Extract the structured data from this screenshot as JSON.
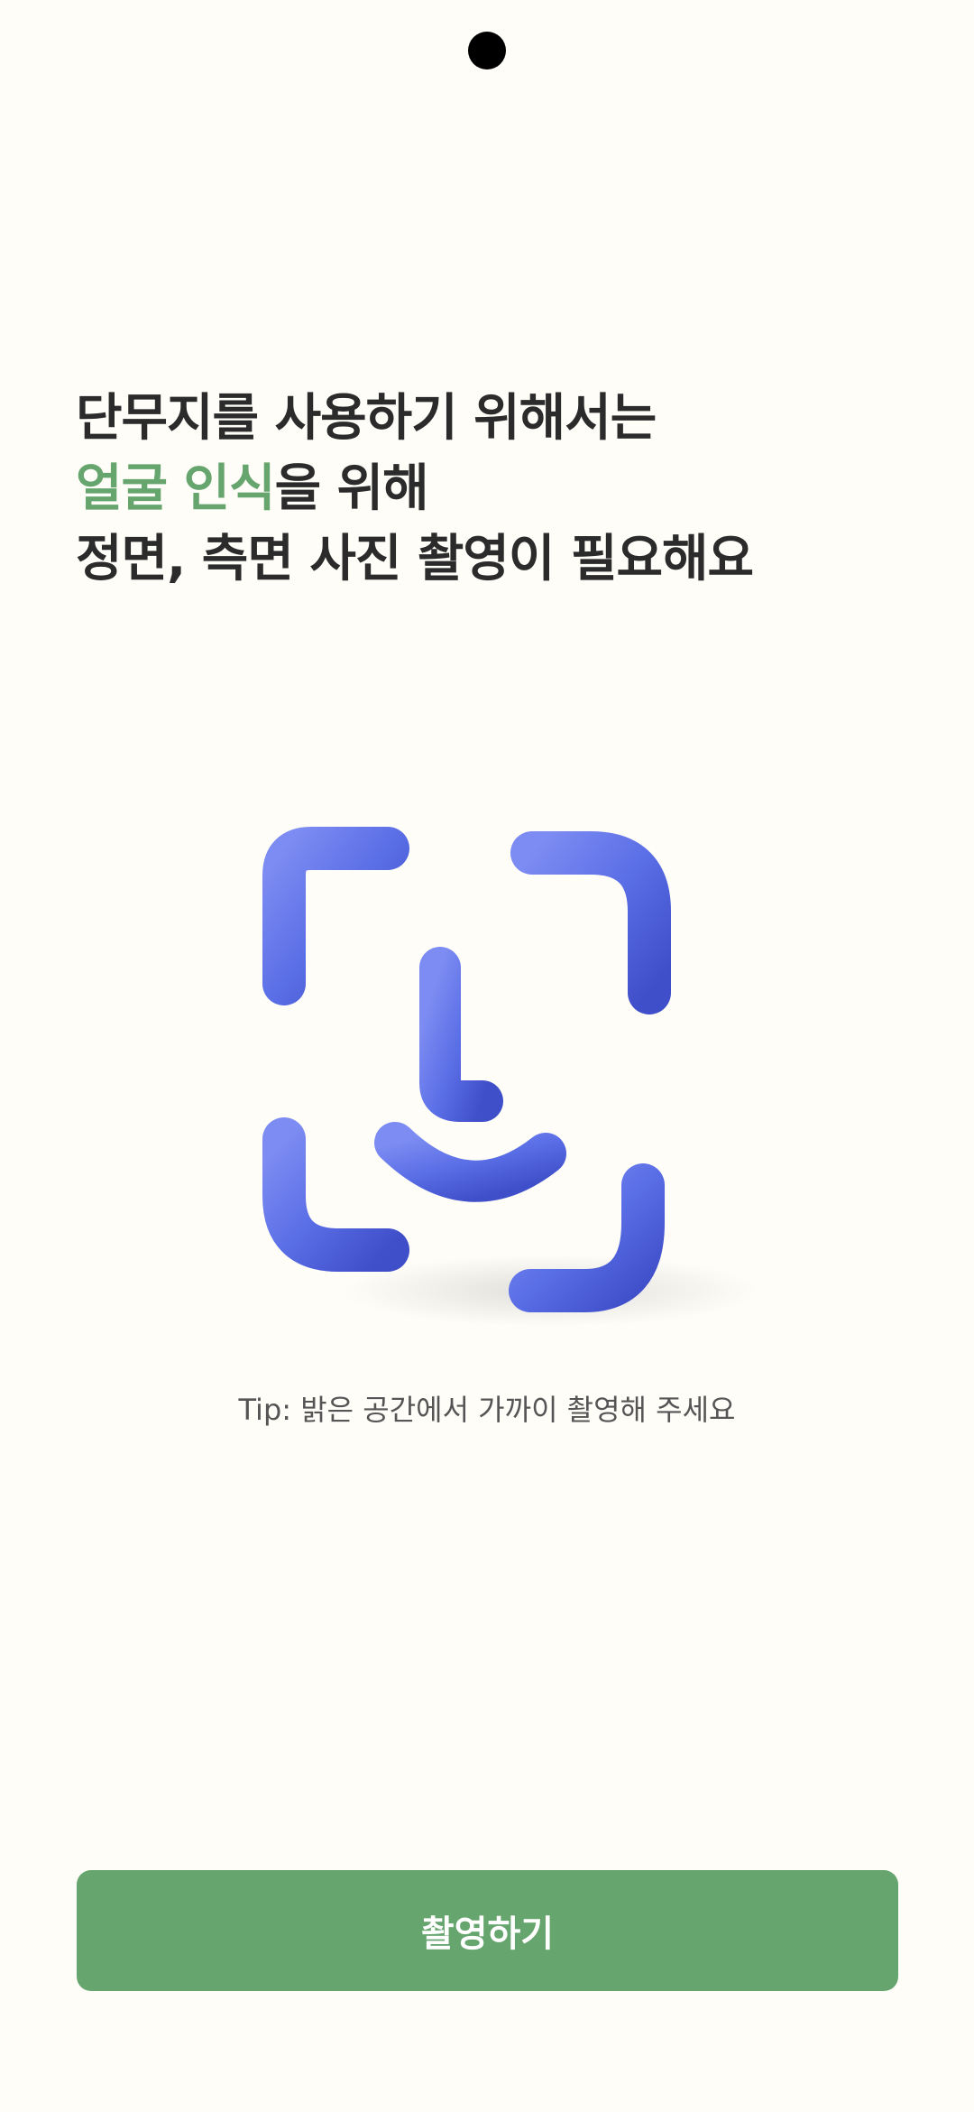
{
  "headline": {
    "line1": "단무지를 사용하기 위해서는",
    "line2_highlight": "얼굴 인식",
    "line2_rest": "을 위해",
    "line3": "정면, 측면 사진 촬영이 필요해요"
  },
  "illustration": {
    "icon": "face-id-icon",
    "color": "#5b6ee6"
  },
  "tip": "Tip: 밝은 공간에서 가까이 촬영해 주세요",
  "primary_button": {
    "label": "촬영하기",
    "color": "#67a56f"
  },
  "colors": {
    "background": "#fffdf8",
    "text": "#2b2b2b",
    "accent": "#67a56f"
  }
}
